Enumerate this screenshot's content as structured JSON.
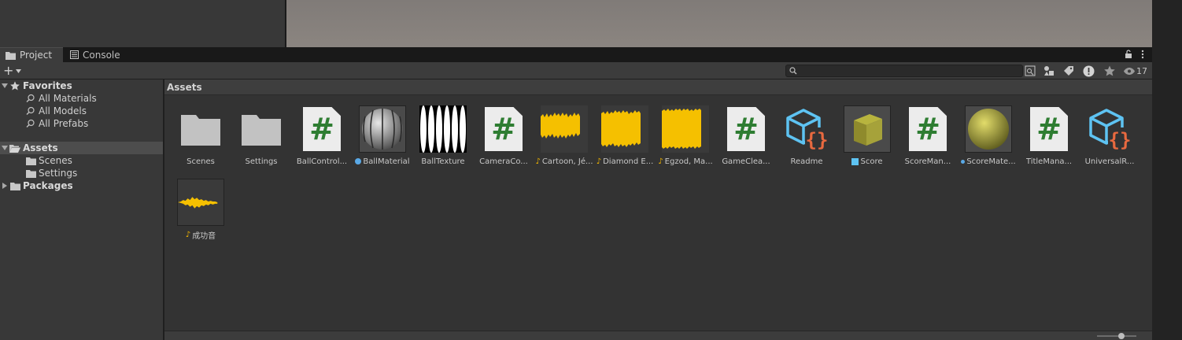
{
  "tabs": [
    {
      "label": "Project"
    },
    {
      "label": "Console"
    }
  ],
  "toolbar": {
    "create_label": "+",
    "search_value": "",
    "search_placeholder": "",
    "hidden_count": "17"
  },
  "tree": {
    "favorites_label": "Favorites",
    "favorites": [
      "All Materials",
      "All Models",
      "All Prefabs"
    ],
    "assets_label": "Assets",
    "assets_children": [
      "Scenes",
      "Settings"
    ],
    "packages_label": "Packages"
  },
  "breadcrumb": "Assets",
  "assets": [
    {
      "name": "Scenes",
      "kind": "folder"
    },
    {
      "name": "Settings",
      "kind": "folder"
    },
    {
      "name": "BallControl...",
      "kind": "script"
    },
    {
      "name": "BallMaterial",
      "kind": "material-ball"
    },
    {
      "name": "BallTexture",
      "kind": "texture"
    },
    {
      "name": "CameraCo...",
      "kind": "script"
    },
    {
      "name": "Cartoon, Jé...",
      "kind": "audio"
    },
    {
      "name": "Diamond E...",
      "kind": "audio"
    },
    {
      "name": "Egzod, Ma...",
      "kind": "audio"
    },
    {
      "name": "GameClea...",
      "kind": "script"
    },
    {
      "name": "Readme",
      "kind": "asset-json"
    },
    {
      "name": "Score",
      "kind": "prefab-cube"
    },
    {
      "name": "ScoreMan...",
      "kind": "script"
    },
    {
      "name": "ScoreMate...",
      "kind": "material-yellow"
    },
    {
      "name": "TitleMana...",
      "kind": "script"
    },
    {
      "name": "UniversalR...",
      "kind": "asset-json"
    },
    {
      "name": "成功音",
      "kind": "audio-wave"
    }
  ],
  "colors": {
    "script_hash": "#2e7d32",
    "audio": "#f5c000",
    "json_icon_outline": "#5ec3f2",
    "json_braces": "#e8693f",
    "cube": "#9e9a2a",
    "yellow_ball": "#b9b43a"
  }
}
